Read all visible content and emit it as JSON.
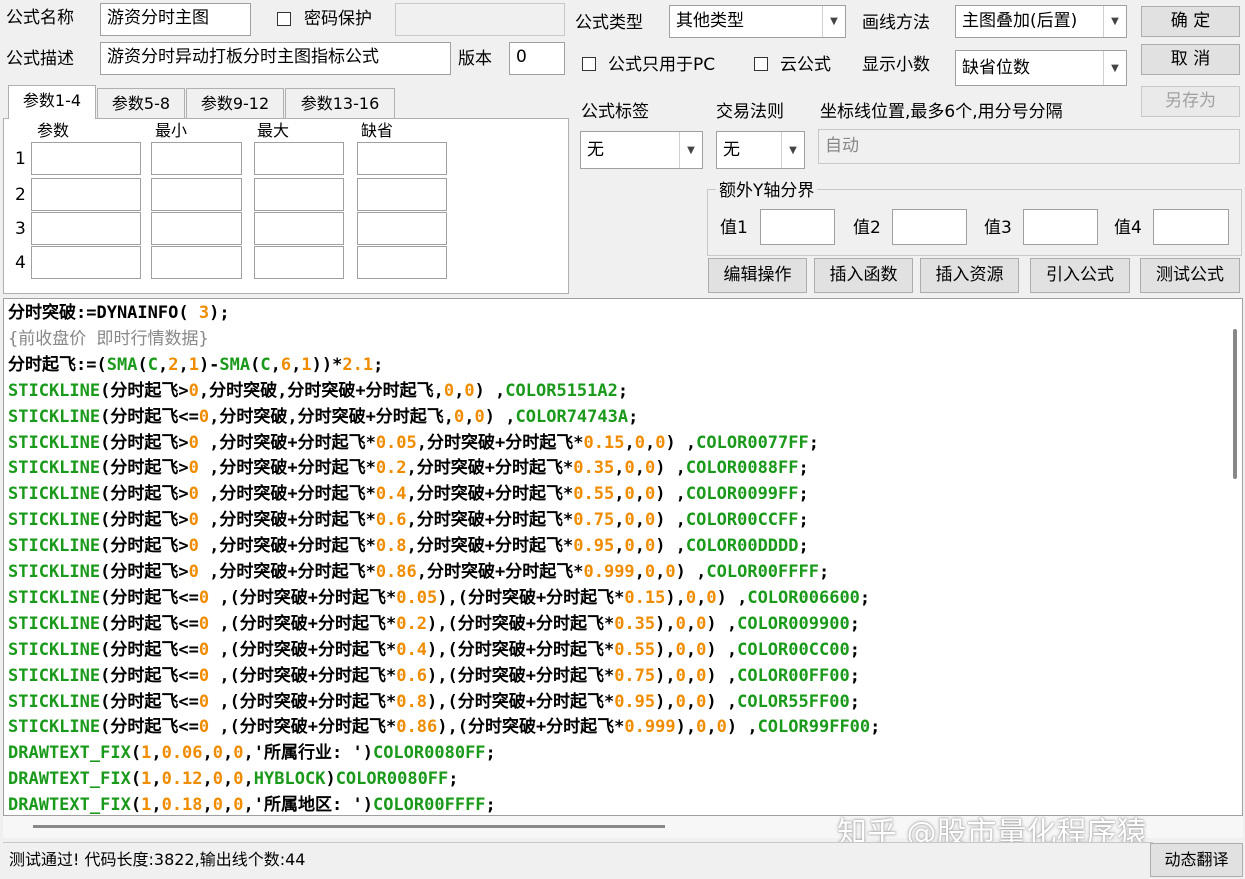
{
  "header": {
    "name_label": "公式名称",
    "name_value": "游资分时主图",
    "password_label": "密码保护",
    "desc_label": "公式描述",
    "desc_value": "游资分时异动打板分时主图指标公式",
    "version_label": "版本",
    "version_value": "0"
  },
  "type_section": {
    "type_label": "公式类型",
    "type_value": "其他类型",
    "draw_label": "画线方法",
    "draw_value": "主图叠加(后置)",
    "pc_only_label": "公式只用于PC",
    "cloud_label": "云公式",
    "decimals_label": "显示小数",
    "decimals_value": "缺省位数"
  },
  "buttons": {
    "ok": "确 定",
    "cancel": "取 消",
    "save_as": "另存为",
    "edit_ops": "编辑操作",
    "insert_func": "插入函数",
    "insert_res": "插入资源",
    "import_formula": "引入公式",
    "test_formula": "测试公式",
    "dynamic_translate": "动态翻译"
  },
  "tabs": [
    "参数1-4",
    "参数5-8",
    "参数9-12",
    "参数13-16"
  ],
  "param_table": {
    "headers": [
      "参数",
      "最小",
      "最大",
      "缺省"
    ],
    "rows": [
      "1",
      "2",
      "3",
      "4"
    ]
  },
  "tag_section": {
    "tag_label": "公式标签",
    "tag_value": "无",
    "rule_label": "交易法则",
    "rule_value": "无",
    "coord_label": "坐标线位置,最多6个,用分号分隔",
    "coord_value": "自动"
  },
  "y_axis": {
    "group_label": "额外Y轴分界",
    "v1": "值1",
    "v2": "值2",
    "v3": "值3",
    "v4": "值4"
  },
  "code": [
    [
      [
        "dk",
        "分时突破:=DYNAINFO( "
      ],
      [
        "num",
        "3"
      ],
      [
        "dk",
        ");"
      ]
    ],
    [
      [
        "cm",
        "{前收盘价 即时行情数据}"
      ]
    ],
    [
      [
        "dk",
        "分时起飞:=("
      ],
      [
        "kw",
        "SMA"
      ],
      [
        "dk",
        "("
      ],
      [
        "kw",
        "C"
      ],
      [
        "dk",
        ","
      ],
      [
        "num",
        "2"
      ],
      [
        "dk",
        ","
      ],
      [
        "num",
        "1"
      ],
      [
        "dk",
        ")-"
      ],
      [
        "kw",
        "SMA"
      ],
      [
        "dk",
        "("
      ],
      [
        "kw",
        "C"
      ],
      [
        "dk",
        ","
      ],
      [
        "num",
        "6"
      ],
      [
        "dk",
        ","
      ],
      [
        "num",
        "1"
      ],
      [
        "dk",
        "))*"
      ],
      [
        "num",
        "2.1"
      ],
      [
        "dk",
        ";"
      ]
    ],
    [
      [
        "kw",
        "STICKLINE"
      ],
      [
        "dk",
        "(分时起飞>"
      ],
      [
        "num",
        "0"
      ],
      [
        "dk",
        ",分时突破,分时突破+分时起飞,"
      ],
      [
        "num",
        "0"
      ],
      [
        "dk",
        ","
      ],
      [
        "num",
        "0"
      ],
      [
        "dk",
        ") ,"
      ],
      [
        "kw",
        "COLOR5151A2"
      ],
      [
        "dk",
        ";"
      ]
    ],
    [
      [
        "kw",
        "STICKLINE"
      ],
      [
        "dk",
        "(分时起飞<="
      ],
      [
        "num",
        "0"
      ],
      [
        "dk",
        ",分时突破,分时突破+分时起飞,"
      ],
      [
        "num",
        "0"
      ],
      [
        "dk",
        ","
      ],
      [
        "num",
        "0"
      ],
      [
        "dk",
        ") ,"
      ],
      [
        "kw",
        "COLOR74743A"
      ],
      [
        "dk",
        ";"
      ]
    ],
    [
      [
        "kw",
        "STICKLINE"
      ],
      [
        "dk",
        "(分时起飞>"
      ],
      [
        "num",
        "0"
      ],
      [
        "dk",
        " ,分时突破+分时起飞*"
      ],
      [
        "num",
        "0.05"
      ],
      [
        "dk",
        ",分时突破+分时起飞*"
      ],
      [
        "num",
        "0.15"
      ],
      [
        "dk",
        ","
      ],
      [
        "num",
        "0"
      ],
      [
        "dk",
        ","
      ],
      [
        "num",
        "0"
      ],
      [
        "dk",
        ") ,"
      ],
      [
        "kw",
        "COLOR0077FF"
      ],
      [
        "dk",
        ";"
      ]
    ],
    [
      [
        "kw",
        "STICKLINE"
      ],
      [
        "dk",
        "(分时起飞>"
      ],
      [
        "num",
        "0"
      ],
      [
        "dk",
        " ,分时突破+分时起飞*"
      ],
      [
        "num",
        "0.2"
      ],
      [
        "dk",
        ",分时突破+分时起飞*"
      ],
      [
        "num",
        "0.35"
      ],
      [
        "dk",
        ","
      ],
      [
        "num",
        "0"
      ],
      [
        "dk",
        ","
      ],
      [
        "num",
        "0"
      ],
      [
        "dk",
        ") ,"
      ],
      [
        "kw",
        "COLOR0088FF"
      ],
      [
        "dk",
        ";"
      ]
    ],
    [
      [
        "kw",
        "STICKLINE"
      ],
      [
        "dk",
        "(分时起飞>"
      ],
      [
        "num",
        "0"
      ],
      [
        "dk",
        " ,分时突破+分时起飞*"
      ],
      [
        "num",
        "0.4"
      ],
      [
        "dk",
        ",分时突破+分时起飞*"
      ],
      [
        "num",
        "0.55"
      ],
      [
        "dk",
        ","
      ],
      [
        "num",
        "0"
      ],
      [
        "dk",
        ","
      ],
      [
        "num",
        "0"
      ],
      [
        "dk",
        ") ,"
      ],
      [
        "kw",
        "COLOR0099FF"
      ],
      [
        "dk",
        ";"
      ]
    ],
    [
      [
        "kw",
        "STICKLINE"
      ],
      [
        "dk",
        "(分时起飞>"
      ],
      [
        "num",
        "0"
      ],
      [
        "dk",
        " ,分时突破+分时起飞*"
      ],
      [
        "num",
        "0.6"
      ],
      [
        "dk",
        ",分时突破+分时起飞*"
      ],
      [
        "num",
        "0.75"
      ],
      [
        "dk",
        ","
      ],
      [
        "num",
        "0"
      ],
      [
        "dk",
        ","
      ],
      [
        "num",
        "0"
      ],
      [
        "dk",
        ") ,"
      ],
      [
        "kw",
        "COLOR00CCFF"
      ],
      [
        "dk",
        ";"
      ]
    ],
    [
      [
        "kw",
        "STICKLINE"
      ],
      [
        "dk",
        "(分时起飞>"
      ],
      [
        "num",
        "0"
      ],
      [
        "dk",
        " ,分时突破+分时起飞*"
      ],
      [
        "num",
        "0.8"
      ],
      [
        "dk",
        ",分时突破+分时起飞*"
      ],
      [
        "num",
        "0.95"
      ],
      [
        "dk",
        ","
      ],
      [
        "num",
        "0"
      ],
      [
        "dk",
        ","
      ],
      [
        "num",
        "0"
      ],
      [
        "dk",
        ") ,"
      ],
      [
        "kw",
        "COLOR00DDDD"
      ],
      [
        "dk",
        ";"
      ]
    ],
    [
      [
        "kw",
        "STICKLINE"
      ],
      [
        "dk",
        "(分时起飞>"
      ],
      [
        "num",
        "0"
      ],
      [
        "dk",
        " ,分时突破+分时起飞*"
      ],
      [
        "num",
        "0.86"
      ],
      [
        "dk",
        ",分时突破+分时起飞*"
      ],
      [
        "num",
        "0.999"
      ],
      [
        "dk",
        ","
      ],
      [
        "num",
        "0"
      ],
      [
        "dk",
        ","
      ],
      [
        "num",
        "0"
      ],
      [
        "dk",
        ") ,"
      ],
      [
        "kw",
        "COLOR00FFFF"
      ],
      [
        "dk",
        ";"
      ]
    ],
    [
      [
        "kw",
        "STICKLINE"
      ],
      [
        "dk",
        "(分时起飞<="
      ],
      [
        "num",
        "0"
      ],
      [
        "dk",
        " ,(分时突破+分时起飞*"
      ],
      [
        "num",
        "0.05"
      ],
      [
        "dk",
        "),(分时突破+分时起飞*"
      ],
      [
        "num",
        "0.15"
      ],
      [
        "dk",
        "),"
      ],
      [
        "num",
        "0"
      ],
      [
        "dk",
        ","
      ],
      [
        "num",
        "0"
      ],
      [
        "dk",
        ") ,"
      ],
      [
        "kw",
        "COLOR006600"
      ],
      [
        "dk",
        ";"
      ]
    ],
    [
      [
        "kw",
        "STICKLINE"
      ],
      [
        "dk",
        "(分时起飞<="
      ],
      [
        "num",
        "0"
      ],
      [
        "dk",
        " ,(分时突破+分时起飞*"
      ],
      [
        "num",
        "0.2"
      ],
      [
        "dk",
        "),(分时突破+分时起飞*"
      ],
      [
        "num",
        "0.35"
      ],
      [
        "dk",
        "),"
      ],
      [
        "num",
        "0"
      ],
      [
        "dk",
        ","
      ],
      [
        "num",
        "0"
      ],
      [
        "dk",
        ") ,"
      ],
      [
        "kw",
        "COLOR009900"
      ],
      [
        "dk",
        ";"
      ]
    ],
    [
      [
        "kw",
        "STICKLINE"
      ],
      [
        "dk",
        "(分时起飞<="
      ],
      [
        "num",
        "0"
      ],
      [
        "dk",
        " ,(分时突破+分时起飞*"
      ],
      [
        "num",
        "0.4"
      ],
      [
        "dk",
        "),(分时突破+分时起飞*"
      ],
      [
        "num",
        "0.55"
      ],
      [
        "dk",
        "),"
      ],
      [
        "num",
        "0"
      ],
      [
        "dk",
        ","
      ],
      [
        "num",
        "0"
      ],
      [
        "dk",
        ") ,"
      ],
      [
        "kw",
        "COLOR00CC00"
      ],
      [
        "dk",
        ";"
      ]
    ],
    [
      [
        "kw",
        "STICKLINE"
      ],
      [
        "dk",
        "(分时起飞<="
      ],
      [
        "num",
        "0"
      ],
      [
        "dk",
        " ,(分时突破+分时起飞*"
      ],
      [
        "num",
        "0.6"
      ],
      [
        "dk",
        "),(分时突破+分时起飞*"
      ],
      [
        "num",
        "0.75"
      ],
      [
        "dk",
        "),"
      ],
      [
        "num",
        "0"
      ],
      [
        "dk",
        ","
      ],
      [
        "num",
        "0"
      ],
      [
        "dk",
        ") ,"
      ],
      [
        "kw",
        "COLOR00FF00"
      ],
      [
        "dk",
        ";"
      ]
    ],
    [
      [
        "kw",
        "STICKLINE"
      ],
      [
        "dk",
        "(分时起飞<="
      ],
      [
        "num",
        "0"
      ],
      [
        "dk",
        " ,(分时突破+分时起飞*"
      ],
      [
        "num",
        "0.8"
      ],
      [
        "dk",
        "),(分时突破+分时起飞*"
      ],
      [
        "num",
        "0.95"
      ],
      [
        "dk",
        "),"
      ],
      [
        "num",
        "0"
      ],
      [
        "dk",
        ","
      ],
      [
        "num",
        "0"
      ],
      [
        "dk",
        ") ,"
      ],
      [
        "kw",
        "COLOR55FF00"
      ],
      [
        "dk",
        ";"
      ]
    ],
    [
      [
        "kw",
        "STICKLINE"
      ],
      [
        "dk",
        "(分时起飞<="
      ],
      [
        "num",
        "0"
      ],
      [
        "dk",
        " ,(分时突破+分时起飞*"
      ],
      [
        "num",
        "0.86"
      ],
      [
        "dk",
        "),(分时突破+分时起飞*"
      ],
      [
        "num",
        "0.999"
      ],
      [
        "dk",
        "),"
      ],
      [
        "num",
        "0"
      ],
      [
        "dk",
        ","
      ],
      [
        "num",
        "0"
      ],
      [
        "dk",
        ") ,"
      ],
      [
        "kw",
        "COLOR99FF00"
      ],
      [
        "dk",
        ";"
      ]
    ],
    [
      [
        "kw",
        "DRAWTEXT_FIX"
      ],
      [
        "dk",
        "("
      ],
      [
        "num",
        "1"
      ],
      [
        "dk",
        ","
      ],
      [
        "num",
        "0.06"
      ],
      [
        "dk",
        ","
      ],
      [
        "num",
        "0"
      ],
      [
        "dk",
        ","
      ],
      [
        "num",
        "0"
      ],
      [
        "dk",
        ",'所属行业: ')"
      ],
      [
        "kw",
        "COLOR0080FF"
      ],
      [
        "dk",
        ";"
      ]
    ],
    [
      [
        "kw",
        "DRAWTEXT_FIX"
      ],
      [
        "dk",
        "("
      ],
      [
        "num",
        "1"
      ],
      [
        "dk",
        ","
      ],
      [
        "num",
        "0.12"
      ],
      [
        "dk",
        ","
      ],
      [
        "num",
        "0"
      ],
      [
        "dk",
        ","
      ],
      [
        "num",
        "0"
      ],
      [
        "dk",
        ","
      ],
      [
        "kw",
        "HYBLOCK"
      ],
      [
        "dk",
        ")"
      ],
      [
        "kw",
        "COLOR0080FF"
      ],
      [
        "dk",
        ";"
      ]
    ],
    [
      [
        "kw",
        "DRAWTEXT_FIX"
      ],
      [
        "dk",
        "("
      ],
      [
        "num",
        "1"
      ],
      [
        "dk",
        ","
      ],
      [
        "num",
        "0.18"
      ],
      [
        "dk",
        ","
      ],
      [
        "num",
        "0"
      ],
      [
        "dk",
        ","
      ],
      [
        "num",
        "0"
      ],
      [
        "dk",
        ",'所属地区: ')"
      ],
      [
        "kw",
        "COLOR00FFFF"
      ],
      [
        "dk",
        ";"
      ]
    ]
  ],
  "status_text": "测试通过! 代码长度:3822,输出线个数:44",
  "watermark": "知乎 @股市量化程序猿",
  "colors": {
    "keyword": "#1a9a1a",
    "number": "#f08c00",
    "comment": "#888888"
  }
}
